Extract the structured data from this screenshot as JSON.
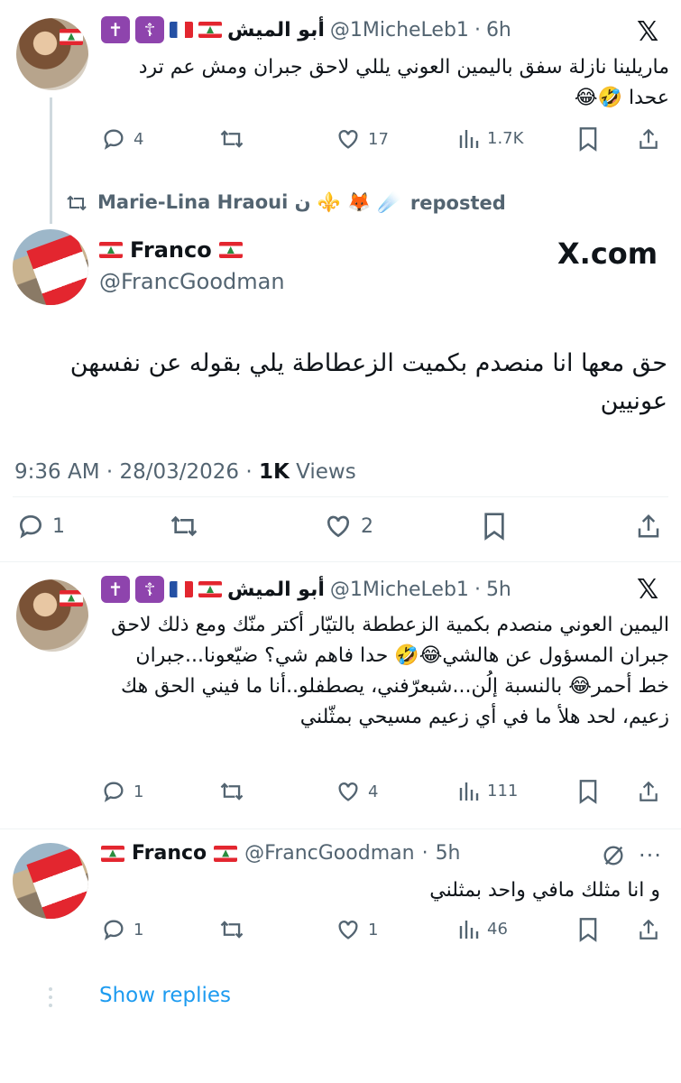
{
  "tweet1": {
    "name": "أبو الميش",
    "handle": "@1MicheLeb1",
    "sep": "·",
    "time": "6h",
    "text": "ماريلينا نازلة سفق باليمين العوني يللي لاحق جبران ومش عم ترد عحدا 🤣😂",
    "stats": {
      "replies": "4",
      "likes": "17",
      "views": "1.7K"
    }
  },
  "repost": {
    "name": "Marie-Lina Hraoui ن ⚜️ 🦊 ☄️",
    "label": "reposted"
  },
  "main": {
    "name": "Franco",
    "handle": "@FrancGoodman",
    "watermark": "X.com",
    "text": "حق معها انا منصدم بكميت الزعطاطة يلي بقوله عن نفسهن عونيين",
    "time": "9:36 AM",
    "sep": "·",
    "date": "28/03/2026",
    "views_count": "1K",
    "views_label": "Views",
    "stats": {
      "replies": "1",
      "likes": "2"
    }
  },
  "tweet2": {
    "name": "أبو الميش",
    "handle": "@1MicheLeb1",
    "sep": "·",
    "time": "5h",
    "text": "اليمين العوني منصدم بكمية الزعططة بالتيّار أكتر منّك ومع ذلك لاحق جبران المسؤول عن هالشي😂🤣 حدا فاهم شي؟ ضيّعونا...جبران خط أحمر😂 بالنسبة إلُن...شبعرّفني، يصطفلو..أنا ما فيني الحق هك زعيم، لحد هلأ ما في أي زعيم مسيحي بمثّلني",
    "stats": {
      "replies": "1",
      "likes": "4",
      "views": "111"
    }
  },
  "reply": {
    "name": "Franco",
    "handle": "@FrancGoodman",
    "sep": "·",
    "time": "5h",
    "text": "و انا مثلك مافي واحد بمثلني",
    "stats": {
      "replies": "1",
      "likes": "1",
      "views": "46"
    }
  },
  "show_replies": "Show replies",
  "colors": {
    "link": "#1d9bf0",
    "muted": "#536471",
    "text": "#0f1419",
    "badge": "#8e44ad"
  }
}
